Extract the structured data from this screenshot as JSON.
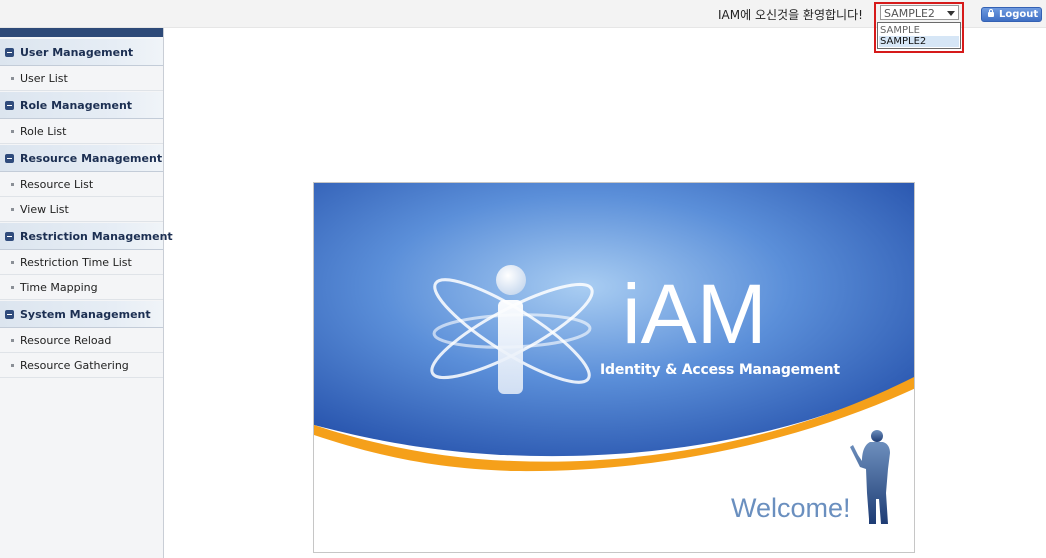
{
  "header": {
    "welcome_text": "IAM에 오신것을 환영합니다!",
    "select": {
      "value": "SAMPLE2",
      "options": [
        "SAMPLE",
        "SAMPLE2"
      ],
      "highlighted_option": "SAMPLE2"
    },
    "logout_label": "Logout",
    "highlight_color": "#d61a1a"
  },
  "sidebar": {
    "categories": [
      {
        "label": "User Management",
        "items": [
          "User List"
        ]
      },
      {
        "label": "Role Management",
        "items": [
          "Role List"
        ]
      },
      {
        "label": "Resource Management",
        "items": [
          "Resource List",
          "View List"
        ]
      },
      {
        "label": "Restriction Management",
        "items": [
          "Restriction Time List",
          "Time Mapping"
        ]
      },
      {
        "label": "System Management",
        "items": [
          "Resource Reload",
          "Resource Gathering"
        ]
      }
    ]
  },
  "banner": {
    "logo_text": "iAM",
    "subtitle": "Identity & Access Management",
    "welcome": "Welcome!"
  },
  "colors": {
    "brand_blue": "#2f63b8",
    "accent_orange": "#f5a01a",
    "sidebar_header": "#2e4a78"
  }
}
